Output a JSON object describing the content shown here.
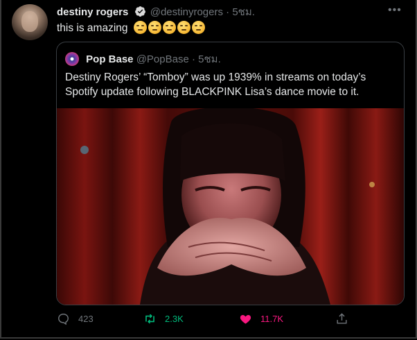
{
  "tweet": {
    "display_name": "destiny rogers",
    "handle": "@destinyrogers",
    "separator": "·",
    "time": "5ชม.",
    "text": "this is amazing"
  },
  "quoted": {
    "display_name": "Pop Base",
    "handle": "@PopBase",
    "separator": "·",
    "time": "5ชม.",
    "text": "Destiny Rogers’ “Tomboy” was up 1939% in streams on today’s Spotify update following BLACKPINK Lisa’s dance movie to it."
  },
  "actions": {
    "replies": "423",
    "retweets": "2.3K",
    "likes": "11.7K"
  },
  "icons": {
    "verified": "verified-badge-icon",
    "more": "more-icon",
    "reply": "reply-icon",
    "retweet": "retweet-icon",
    "like": "heart-icon",
    "share": "share-icon"
  },
  "colors": {
    "retweet_active": "#00ba7c",
    "like_active": "#f91880",
    "verified": "#1d9bf0"
  }
}
